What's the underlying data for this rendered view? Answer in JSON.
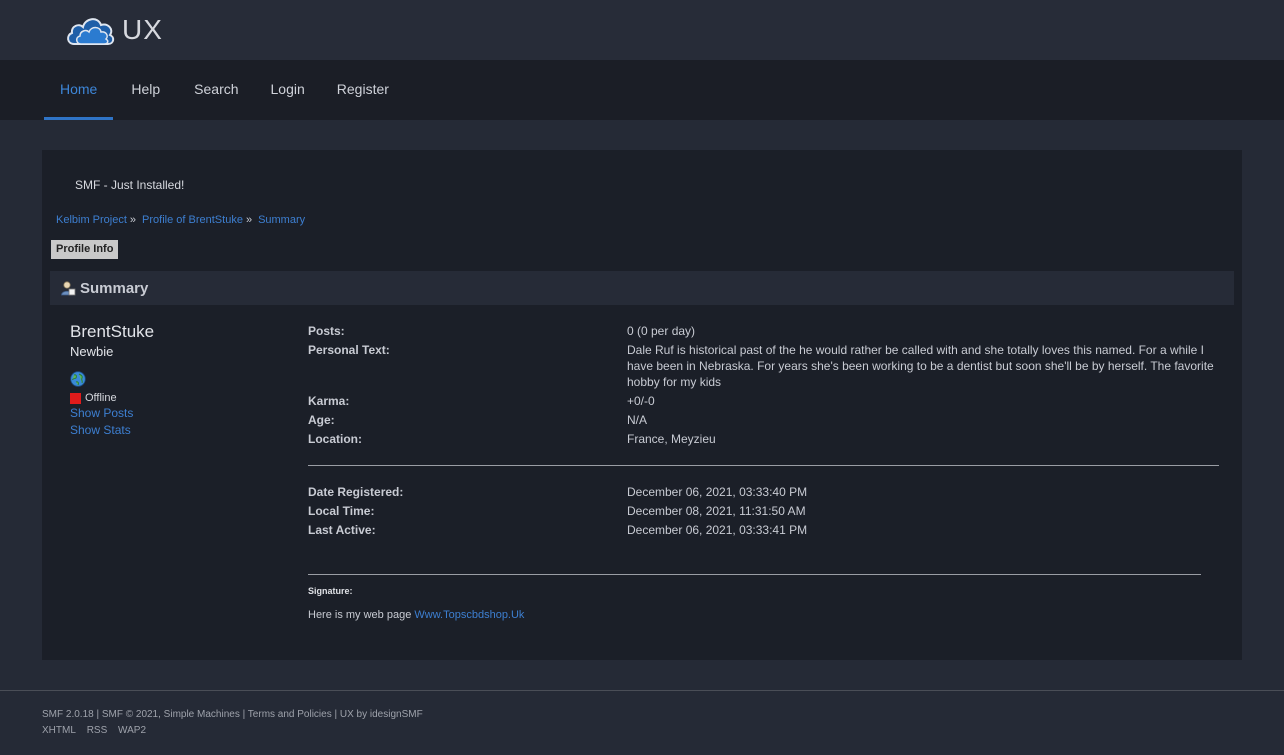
{
  "header": {
    "logo_text": "UX",
    "logo_icon": "cloud-icon"
  },
  "nav": {
    "items": [
      "Home",
      "Help",
      "Search",
      "Login",
      "Register"
    ],
    "active": "Home"
  },
  "forum": {
    "title": "SMF - Just Installed!"
  },
  "breadcrumb": [
    "Kelbim Project",
    "Profile of BrentStuke",
    "Summary"
  ],
  "breadcrumb_sep": "»",
  "profile_tab": "Profile Info",
  "section": {
    "title": "Summary",
    "icon": "user-summary-icon"
  },
  "user": {
    "name": "BrentStuke",
    "position": "Newbie",
    "status": "Offline",
    "links": [
      "Show Posts",
      "Show Stats"
    ]
  },
  "details": [
    {
      "label": "Posts:",
      "value": "0 (0 per day)"
    },
    {
      "label": "Personal Text:",
      "value": "Dale Ruf is historical past of the he would rather be called with and she totally loves this named. For a while I have been in Nebraska. For years she's been working to be a dentist but soon she'll be by herself. The favorite hobby for my kids"
    },
    {
      "label": "Karma:",
      "value": "+0/-0"
    },
    {
      "label": "Age:",
      "value": "N/A"
    },
    {
      "label": "Location:",
      "value": "France, Meyzieu"
    }
  ],
  "dates": [
    {
      "label": "Date Registered:",
      "value": "December 06, 2021, 03:33:40 PM"
    },
    {
      "label": "Local Time:",
      "value": "December 08, 2021, 11:31:50 AM"
    },
    {
      "label": "Last Active:",
      "value": "December 06, 2021, 03:33:41 PM"
    }
  ],
  "signature": {
    "label": "Signature",
    "text": "Here is my web page ",
    "link": "Www.Topscbdshop.Uk"
  },
  "footer": {
    "line1": "SMF 2.0.18 | SMF © 2021, Simple Machines | Terms and Policies | UX by idesignSMF",
    "links": [
      "XHTML",
      "RSS",
      "WAP2"
    ]
  },
  "colors": {
    "accent": "#3d7fd1",
    "offline": "#e01b1b"
  }
}
